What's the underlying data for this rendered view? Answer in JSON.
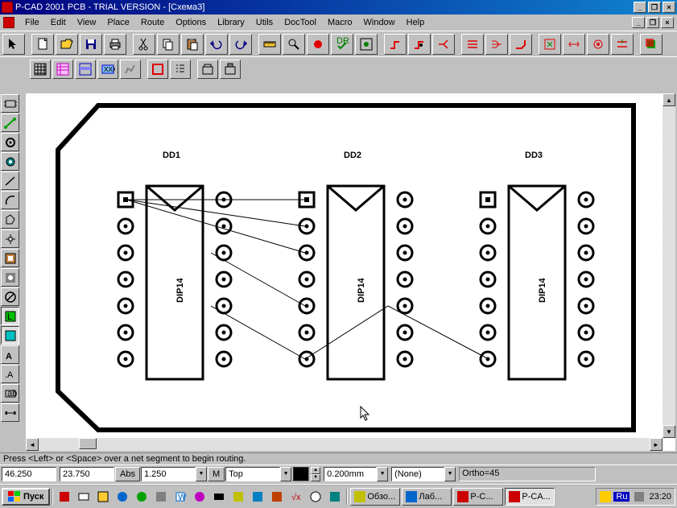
{
  "title": "P-CAD 2001 PCB - TRIAL VERSION  - [Схема3]",
  "menu": [
    "File",
    "Edit",
    "View",
    "Place",
    "Route",
    "Options",
    "Library",
    "Utils",
    "DocTool",
    "Macro",
    "Window",
    "Help"
  ],
  "components": [
    {
      "ref": "DD1",
      "type": "DIP14"
    },
    {
      "ref": "DD2",
      "type": "DIP14"
    },
    {
      "ref": "DD3",
      "type": "DIP14"
    }
  ],
  "hint": "Press <Left> or <Space> over a net segment to begin routing.",
  "coord_x": "46.250",
  "coord_y": "23.750",
  "abs_btn": "Abs",
  "grid": "1.250",
  "m_btn": "M",
  "layer": "Top",
  "trace_w": "0.200mm",
  "net": "(None)",
  "ortho": "Ortho=45",
  "start": "Пуск",
  "tasks": [
    "Обзо...",
    "Лаб...",
    "P-C...",
    "P-CA..."
  ],
  "lang": "Ru",
  "clock": "23:20"
}
